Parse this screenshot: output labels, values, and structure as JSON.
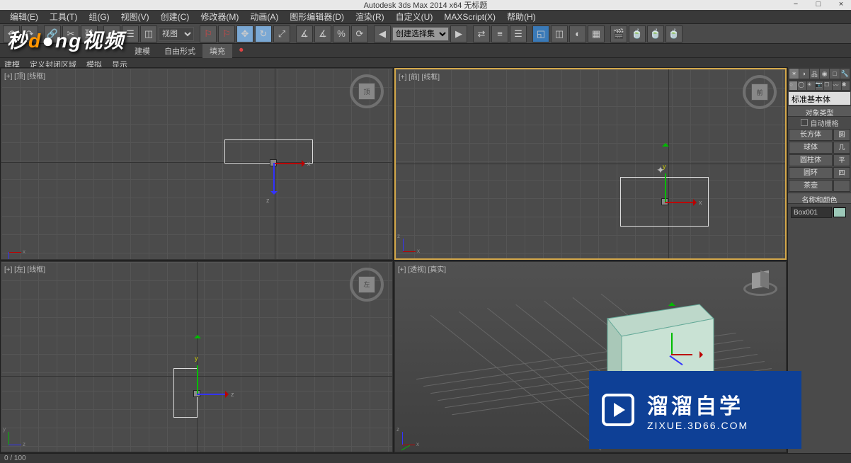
{
  "title": "Autodesk 3ds Max  2014 x64     无标题",
  "win": {
    "min": "−",
    "max": "□",
    "close": "×"
  },
  "menu": [
    "编辑(E)",
    "工具(T)",
    "组(G)",
    "视图(V)",
    "创建(C)",
    "修改器(M)",
    "动画(A)",
    "图形编辑器(D)",
    "渲染(R)",
    "自定义(U)",
    "MAXScript(X)",
    "帮助(H)"
  ],
  "toolbar": {
    "view_dropdown": "视图",
    "selset_dropdown": "创建选择集"
  },
  "toolbar2": {
    "tab1": "建模",
    "tab2": "自由形式",
    "tab3": "填充",
    "camera": "⏺"
  },
  "toolbar3": [
    "建模",
    "定义封闭区域",
    "模拟",
    "显示"
  ],
  "viewports": {
    "tl": "[+] [顶] [线框]",
    "tr": "[+] [前] [线框]",
    "bl": "[+] [左] [线框]",
    "br": "[+] [透视] [真实]"
  },
  "gizmo": {
    "x": "x",
    "y": "y",
    "z": "z"
  },
  "cmd": {
    "dropdown": "标准基本体",
    "rollout_objtype": "对象类型",
    "autogrid": "自动栅格",
    "buttons": [
      [
        "长方体",
        "圆"
      ],
      [
        "球体",
        "几"
      ],
      [
        "圆柱体",
        "平"
      ],
      [
        "圆环",
        "四"
      ],
      [
        "茶壶",
        ""
      ]
    ],
    "rollout_namecolor": "名称和颜色",
    "objname": "Box001"
  },
  "status": {
    "frame": "0 / 100"
  },
  "wm": {
    "t1": "秒",
    "t2": "d",
    "t3": "ng",
    "t4": "视频"
  },
  "zixue": {
    "big": "溜溜自学",
    "small": "ZIXUE.3D66.COM"
  }
}
